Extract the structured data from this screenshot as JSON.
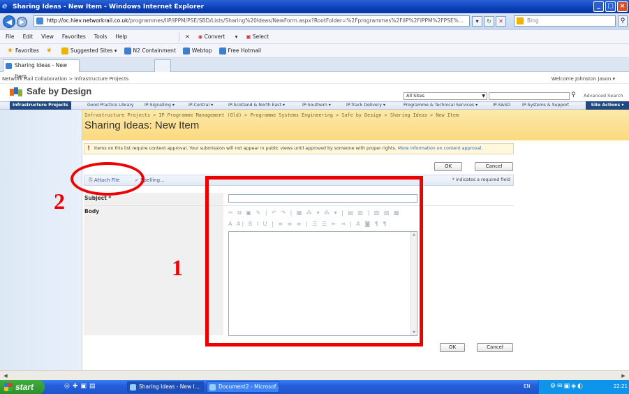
{
  "window": {
    "title": "Sharing Ideas - New Item - Windows Internet Explorer",
    "buttons": {
      "minimize": "_",
      "maximize": "□",
      "close": "×"
    }
  },
  "addressbar": {
    "url_host": "http://oc.hiev.networkrail.co.uk",
    "url_path": "/programmes/IIP/IPPM/PSE/SBD/Lists/Sharing%20Ideas/NewForm.aspx?RootFolder=%2Fprogrammes%2FIIP%2FIPPM%2FPSE%...",
    "search_placeholder": "Bing"
  },
  "menubar": {
    "items": [
      "File",
      "Edit",
      "View",
      "Favorites",
      "Tools",
      "Help"
    ],
    "convert": "Convert",
    "select": "Select"
  },
  "favoritesbar": {
    "favorites": "Favorites",
    "items": [
      "Suggested Sites ▾",
      "N2 Containment",
      "Webtop",
      "Free Hotmail"
    ]
  },
  "tab": {
    "label": "Sharing Ideas - New Item"
  },
  "sharepoint": {
    "top_crumb": "Network Rail Collaboration > Infrastructure Projects",
    "welcome": "Welcome Johnston Jason ▾",
    "site_title": "Safe by Design",
    "search_scope": "All Sites",
    "advanced_search": "Advanced Search",
    "topnav": {
      "active": "Infrastructure Projects",
      "items": [
        "Good Practice Library",
        "IP-Signalling ▾",
        "IP-Central ▾",
        "IP-Scotland & North East ▾",
        "IP-Southern ▾",
        "IP-Track Delivery ▾",
        "Programme & Technical Services ▾",
        "IP-S&SD",
        "IP-Systems & Support"
      ],
      "site_actions": "Site Actions ▾"
    },
    "breadcrumb": "Infrastructure Projects > IP Programme Management (Old) > Programme Systems Engineering > Safe by Design > Sharing Ideas > New Item",
    "page_title": "Sharing Ideas: New Item",
    "approval_text": "Items on this list require content approval. Your submission will not appear in public views until approved by someone with proper rights.",
    "approval_link": "More information on content approval.",
    "ok": "OK",
    "cancel": "Cancel",
    "attach_file": "Attach File",
    "spelling": "Spelling...",
    "required_note": "indicates a required field",
    "required_mark": "*",
    "fields": {
      "subject": "Subject *",
      "body": "Body"
    },
    "rte_toolbar1": "✂ ⧉ ▣ ✎ | ↶ ↷ | ▦ ⁂ ▾ ⁂ ▾ | ▤ ▥ | ▧ ▨ ▩",
    "rte_toolbar2": "A A| B I U | ≡ ≡ ≡ | ☰ ☰ ⇤ ⇥ | A ◙ ¶ ¶"
  },
  "annotations": {
    "one": "1",
    "two": "2"
  },
  "taskbar": {
    "start": "start",
    "items": [
      "Sharing Ideas - New I...",
      "Document2 - Microsof..."
    ],
    "lang": "EN",
    "clock": "22:21"
  },
  "colors": {
    "annotation": "#e00000",
    "sp_nav": "#21497f",
    "title_band": "#fbd97f"
  }
}
